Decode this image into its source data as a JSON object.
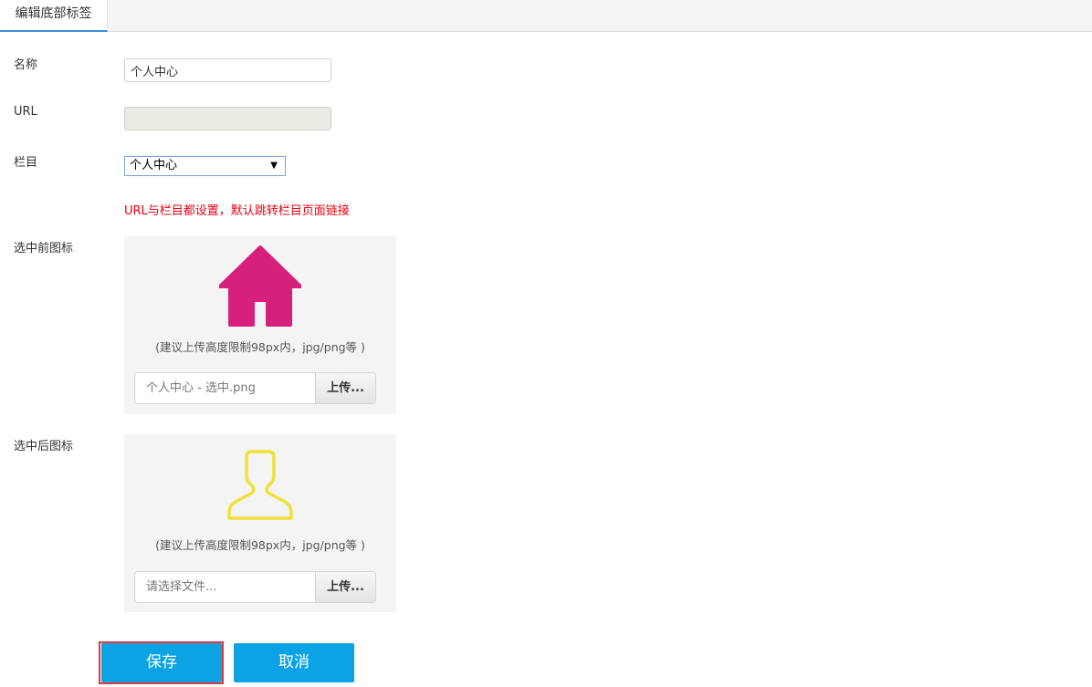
{
  "tab": {
    "label": "编辑底部标签"
  },
  "form": {
    "name_label": "名称",
    "name_value": "个人中心",
    "url_label": "URL",
    "url_value": "",
    "column_label": "栏目",
    "column_selected": "个人中心",
    "hint": "URL与栏目都设置，默认跳转栏目页面链接",
    "icon_before_label": "选中前图标",
    "icon_after_label": "选中后图标"
  },
  "upload_before": {
    "tip": "(建议上传高度限制98px内，jpg/png等 )",
    "file_name": "个人中心 - 选中.png",
    "button": "上传..."
  },
  "upload_after": {
    "tip": "(建议上传高度限制98px内，jpg/png等 )",
    "file_name": "请选择文件...",
    "button": "上传..."
  },
  "actions": {
    "save": "保存",
    "cancel": "取消"
  },
  "colors": {
    "home_icon": "#d6207c",
    "user_icon": "#f0e13a",
    "hint": "#e60012",
    "primary_button": "#0ba3e3",
    "tab_active_border": "#3c8dde"
  },
  "icons": {
    "before": "home-icon",
    "after": "user-outline-icon"
  }
}
